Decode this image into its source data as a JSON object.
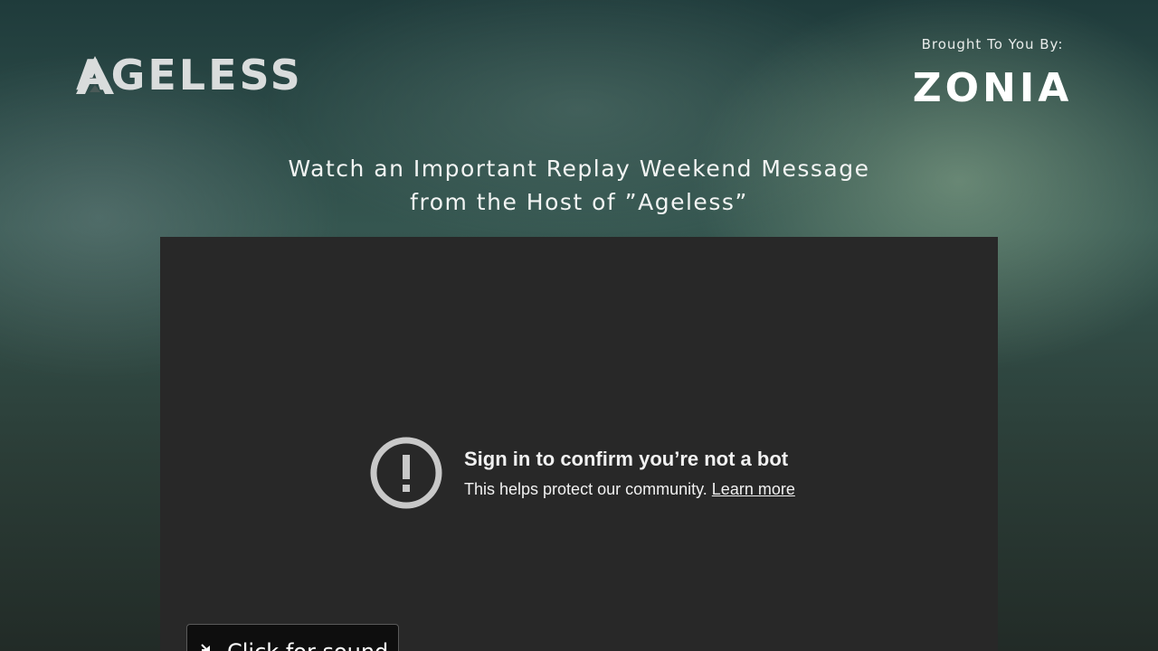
{
  "header": {
    "brand_name": "AGELESS",
    "sponsor_label": "Brought To You By:",
    "sponsor_name": "ZONIA"
  },
  "headline": {
    "line1": "Watch an Important Replay Weekend Message",
    "line2": "from the Host of ”Ageless”"
  },
  "video": {
    "notice_title": "Sign in to confirm you’re not a bot",
    "notice_text": "This helps protect our community.",
    "learn_more": "Learn more",
    "sound_button": "Click for sound"
  },
  "colors": {
    "video_bg": "#282828",
    "text_light": "#f1f1f1",
    "alert_icon": "#c8c8c8"
  },
  "icons": {
    "alert": "exclamation-circle-icon",
    "mute": "speaker-muted-icon",
    "brand_mark": "hourglass-a-icon"
  }
}
